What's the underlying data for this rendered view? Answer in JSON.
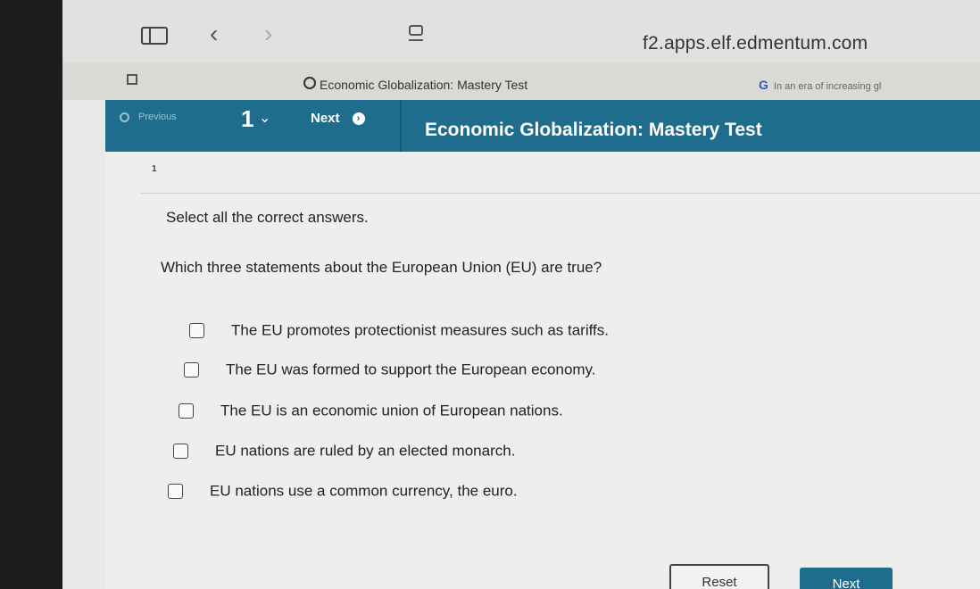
{
  "browser": {
    "url": "f2.apps.elf.edmentum.com",
    "tabs": [
      {
        "title": "Economic Globalization: Mastery Test"
      },
      {
        "title": "In an era of increasing gl"
      }
    ]
  },
  "appbar": {
    "previous_label": "Previous",
    "question_number": "1",
    "next_label": "Next",
    "title": "Economic Globalization: Mastery Test"
  },
  "question": {
    "number": "1",
    "instruction": "Select all the correct answers.",
    "prompt": "Which three statements about the European Union (EU) are true?",
    "options": [
      {
        "text": "The EU promotes protectionist measures such as tariffs."
      },
      {
        "text": "The EU was formed to support the European economy."
      },
      {
        "text": "The EU is an economic union of European nations."
      },
      {
        "text": "EU nations are ruled by an elected monarch."
      },
      {
        "text": "EU nations use a common currency, the euro."
      }
    ]
  },
  "buttons": {
    "reset_label": "Reset",
    "submit_label": "Next"
  },
  "colors": {
    "accent": "#1f6d8c"
  }
}
